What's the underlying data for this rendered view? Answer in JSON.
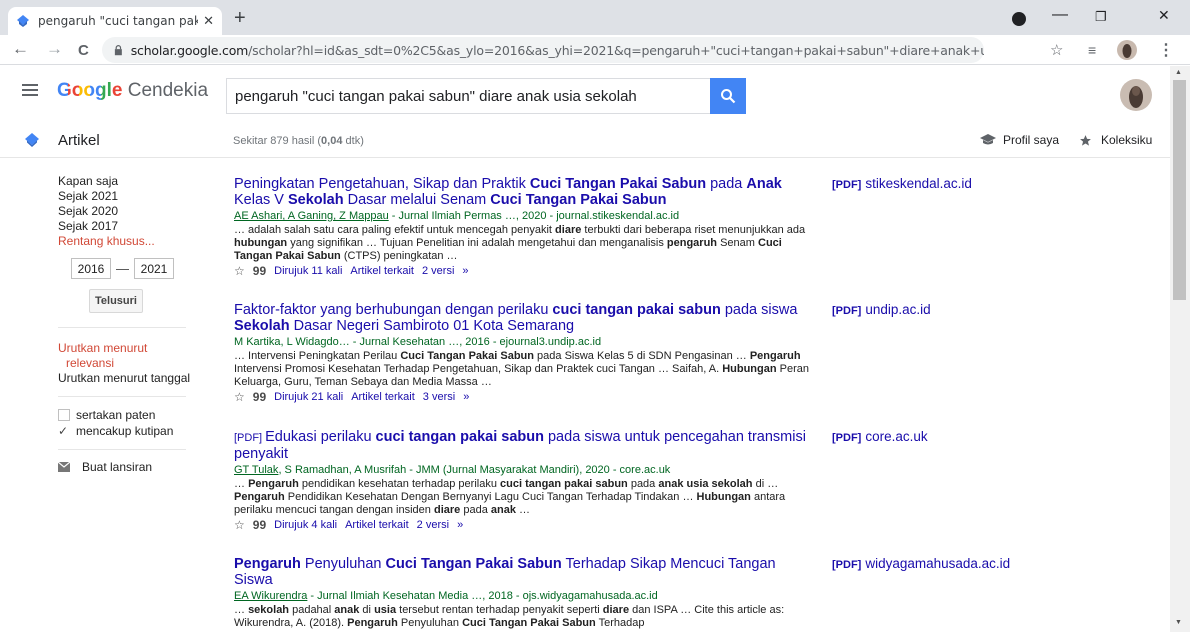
{
  "browser": {
    "tab_title": "pengaruh \"cuci tangan pakai sab",
    "tab_close": "✕",
    "new_tab": "+",
    "url_host": "scholar.google.com",
    "url_path": "/scholar?hl=id&as_sdt=0%2C5&as_ylo=2016&as_yhi=2021&q=pengaruh+\"cuci+tangan+pakai+sabun\"+diare+anak+usia+sekolah&btnG=",
    "back": "←",
    "forward": "→",
    "reload": "C",
    "minimize": "—",
    "restore": "❐",
    "close": "✕",
    "star": "☆",
    "menu": "⋮",
    "playlist": "≡"
  },
  "header": {
    "logo_google": "Google",
    "logo_cendekia": "Cendekia",
    "search_value": "pengaruh \"cuci tangan pakai sabun\" diare anak usia sekolah"
  },
  "subheader": {
    "artikel": "Artikel",
    "count_prefix": "Sekitar 879 hasil (",
    "count_time": "0,04",
    "count_suffix": " dtk)",
    "profil": "Profil saya",
    "koleksi": "Koleksiku"
  },
  "sidebar": {
    "time_options": [
      "Kapan saja",
      "Sejak 2021",
      "Sejak 2020",
      "Sejak 2017"
    ],
    "custom_range": "Rentang khusus...",
    "year_from": "2016",
    "year_dash": "—",
    "year_to": "2021",
    "search_button": "Telusuri",
    "sort_relevance_1": "Urutkan menurut",
    "sort_relevance_2": "relevansi",
    "sort_date": "Urutkan menurut tanggal",
    "include_patents": "sertakan paten",
    "include_citations": "mencakup kutipan",
    "citations_check": "✓",
    "create_alert": "Buat lansiran"
  },
  "actions": {
    "star": "☆",
    "quote": "99",
    "related": "Artikel terkait",
    "more": "»"
  },
  "results": [
    {
      "title_parts": [
        [
          "Peningkatan Pengetahuan, Sikap dan Praktik ",
          false
        ],
        [
          "Cuci Tangan Pakai Sabun",
          true
        ],
        [
          " pada ",
          false
        ],
        [
          "Anak",
          true
        ],
        [
          " Kelas V ",
          false
        ],
        [
          "Sekolah",
          true
        ],
        [
          " Dasar melalui Senam ",
          false
        ],
        [
          "Cuci Tangan Pakai Sabun",
          true
        ]
      ],
      "authors_link": "AE Ashari, A Ganing, Z Mappau",
      "meta_rest": " - Jurnal Ilmiah Permas …, 2020 - journal.stikeskendal.ac.id",
      "snippet_parts": [
        [
          "… adalah salah satu cara paling efektif untuk mencegah penyakit ",
          false
        ],
        [
          "diare",
          true
        ],
        [
          " terbukti dari beberapa riset menunjukkan ada ",
          false
        ],
        [
          "hubungan",
          true
        ],
        [
          " yang signifikan … Tujuan Penelitian ini adalah mengetahui dan menganalisis ",
          false
        ],
        [
          "pengaruh",
          true
        ],
        [
          " Senam ",
          false
        ],
        [
          "Cuci Tangan Pakai Sabun",
          true
        ],
        [
          " (CTPS) peningkatan …",
          false
        ]
      ],
      "cited": "Dirujuk 11 kali",
      "versions": "2 versi",
      "side_tag": "[PDF]",
      "side_host": "stikeskendal.ac.id"
    },
    {
      "title_parts": [
        [
          "Faktor-faktor yang berhubungan dengan perilaku ",
          false
        ],
        [
          "cuci tangan pakai sabun",
          true
        ],
        [
          " pada siswa ",
          false
        ],
        [
          "Sekolah",
          true
        ],
        [
          " Dasar Negeri Sambiroto 01 Kota Semarang",
          false
        ]
      ],
      "authors_link": "",
      "meta_rest": "M Kartika, L Widagdo… - Jurnal Kesehatan …, 2016 - ejournal3.undip.ac.id",
      "snippet_parts": [
        [
          "… Intervensi Peningkatan Perilau ",
          false
        ],
        [
          "Cuci Tangan Pakai Sabun",
          true
        ],
        [
          " pada Siswa Kelas 5 di SDN Pengasinan … ",
          false
        ],
        [
          "Pengaruh",
          true
        ],
        [
          " Intervensi Promosi Kesehatan Terhadap Pengetahuan, Sikap dan Praktek cuci Tangan … Saifah, A. ",
          false
        ],
        [
          "Hubungan",
          true
        ],
        [
          " Peran Keluarga, Guru, Teman Sebaya dan Media Massa …",
          false
        ]
      ],
      "cited": "Dirujuk 21 kali",
      "versions": "3 versi",
      "side_tag": "[PDF]",
      "side_host": "undip.ac.id"
    },
    {
      "title_badge": "[PDF]",
      "title_parts": [
        [
          "Edukasi perilaku ",
          false
        ],
        [
          "cuci tangan pakai sabun",
          true
        ],
        [
          " pada siswa untuk pencegahan transmisi penyakit",
          false
        ]
      ],
      "authors_link": "GT Tulak",
      "meta_rest": ", S Ramadhan, A Musrifah - JMM (Jurnal Masyarakat Mandiri), 2020 - core.ac.uk",
      "snippet_parts": [
        [
          "… ",
          false
        ],
        [
          "Pengaruh",
          true
        ],
        [
          " pendidikan kesehatan terhadap perilaku ",
          false
        ],
        [
          "cuci tangan pakai sabun",
          true
        ],
        [
          " pada ",
          false
        ],
        [
          "anak usia sekolah",
          true
        ],
        [
          " di … ",
          false
        ],
        [
          "Pengaruh",
          true
        ],
        [
          " Pendidikan Kesehatan Dengan Bernyanyi Lagu Cuci Tangan Terhadap Tindakan … ",
          false
        ],
        [
          "Hubungan",
          true
        ],
        [
          " antara perilaku mencuci tangan dengan insiden ",
          false
        ],
        [
          "diare",
          true
        ],
        [
          " pada ",
          false
        ],
        [
          "anak",
          true
        ],
        [
          " …",
          false
        ]
      ],
      "cited": "Dirujuk 4 kali",
      "versions": "2 versi",
      "side_tag": "[PDF]",
      "side_host": "core.ac.uk"
    },
    {
      "title_parts": [
        [
          "Pengaruh",
          true
        ],
        [
          " Penyuluhan ",
          false
        ],
        [
          "Cuci Tangan Pakai Sabun",
          true
        ],
        [
          " Terhadap Sikap Mencuci Tangan Siswa",
          false
        ]
      ],
      "authors_link": "EA Wikurendra",
      "meta_rest": " - Jurnal Ilmiah Kesehatan Media …, 2018 - ojs.widyagamahusada.ac.id",
      "snippet_parts": [
        [
          "… ",
          false
        ],
        [
          "sekolah",
          true
        ],
        [
          " padahal ",
          false
        ],
        [
          "anak",
          true
        ],
        [
          " di ",
          false
        ],
        [
          "usia",
          true
        ],
        [
          " tersebut rentan terhadap penyakit seperti ",
          false
        ],
        [
          "diare",
          true
        ],
        [
          " dan ISPA … Cite this article as: Wikurendra, A. (2018). ",
          false
        ],
        [
          "Pengaruh",
          true
        ],
        [
          " Penyuluhan ",
          false
        ],
        [
          "Cuci Tangan Pakai Sabun",
          true
        ],
        [
          " Terhadap",
          false
        ]
      ],
      "cited": "",
      "versions": "",
      "side_tag": "[PDF]",
      "side_host": "widyagamahusada.ac.id"
    }
  ],
  "colors": {
    "link": "#1a0dab",
    "green": "#006621",
    "red": "#d14836",
    "search_blue": "#4285f4"
  }
}
